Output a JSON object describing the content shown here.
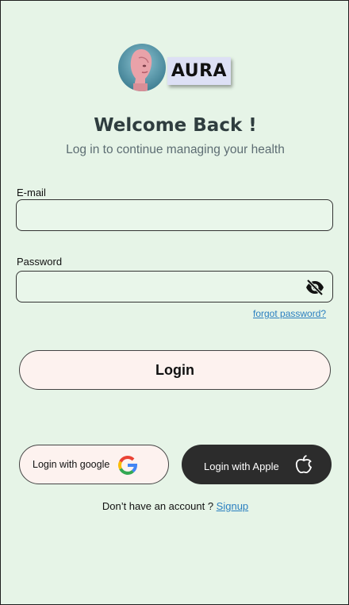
{
  "brand": {
    "name": "AURA"
  },
  "header": {
    "title": "Welcome Back !",
    "subtitle": "Log in to continue managing your health"
  },
  "form": {
    "email_label": "E-mail",
    "email_value": "",
    "password_label": "Password",
    "password_value": "",
    "forgot_password": "forgot password?",
    "login_button": "Login"
  },
  "social": {
    "google_label": "Login with google",
    "apple_label": "Login  with Apple"
  },
  "footer": {
    "prompt": "Don’t have an account ? ",
    "signup_link": "Signup"
  },
  "icons": {
    "avatar": "robot-head-avatar",
    "visibility": "eye-off-icon",
    "google": "google-icon",
    "apple": "apple-icon"
  },
  "colors": {
    "background": "#e6f4e7",
    "link": "#2a7fc0",
    "primary_button": "#fdf2ef",
    "apple_button": "#2c2c2c",
    "title": "#2f3d3f"
  }
}
